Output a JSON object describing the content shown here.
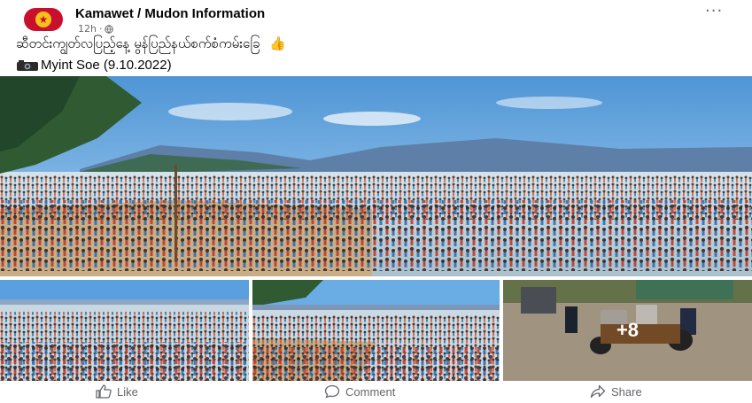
{
  "post": {
    "page_name": "Kamawet / Mudon Information",
    "time": "12h",
    "separator": "·",
    "caption": "ဆီတင်းကျွတ်လပြည့်နေ့ မွန်ပြည်နယ်စက်စံကမ်းခြေ",
    "caption_emoji": "👍",
    "credit": "Myint Soe (9.10.2022)",
    "more_photos": "+8"
  },
  "icons": {
    "avatar": "page-logo-icon",
    "audience": "globe-icon",
    "options": "more-dots-icon",
    "credit": "camera-icon",
    "like": "thumb-up-icon",
    "comment": "comment-icon",
    "share": "share-icon"
  },
  "actions": {
    "like": "Like",
    "comment": "Comment",
    "share": "Share"
  },
  "colors": {
    "brand_red": "#c8102e",
    "text": "#050505",
    "muted": "#65676b",
    "sky": "#8cc3ea",
    "sea": "#bdd3e0",
    "sand": "#cdb38e"
  }
}
